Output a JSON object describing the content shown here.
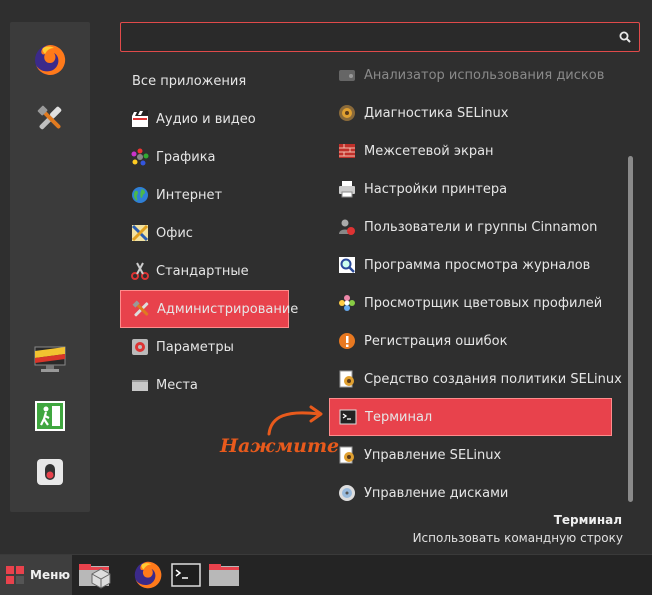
{
  "search": {
    "value": "",
    "placeholder": ""
  },
  "categories": [
    {
      "label": "Все приложения",
      "icon": "none"
    },
    {
      "label": "Аудио и видео",
      "icon": "clapperboard-icon"
    },
    {
      "label": "Графика",
      "icon": "palette-icon"
    },
    {
      "label": "Интернет",
      "icon": "globe-icon"
    },
    {
      "label": "Офис",
      "icon": "office-icon"
    },
    {
      "label": "Стандартные",
      "icon": "scissors-icon"
    },
    {
      "label": "Администрирование",
      "icon": "tools-icon",
      "selected": true
    },
    {
      "label": "Параметры",
      "icon": "settings-icon"
    },
    {
      "label": "Места",
      "icon": "folder-icon"
    }
  ],
  "apps": [
    {
      "label": "Анализатор использования дисков",
      "icon": "disk-usage-icon",
      "dim": true
    },
    {
      "label": "Диагностика SELinux",
      "icon": "selinux-diagnostic-icon"
    },
    {
      "label": "Межсетевой экран",
      "icon": "firewall-icon"
    },
    {
      "label": "Настройки принтера",
      "icon": "printer-icon"
    },
    {
      "label": "Пользователи и группы Cinnamon",
      "icon": "users-icon"
    },
    {
      "label": "Программа просмотра журналов",
      "icon": "log-viewer-icon"
    },
    {
      "label": "Просмотрщик цветовых профилей",
      "icon": "color-profile-icon"
    },
    {
      "label": "Регистрация ошибок",
      "icon": "bug-report-icon"
    },
    {
      "label": "Средство создания политики SELinux",
      "icon": "selinux-policy-icon"
    },
    {
      "label": "Терминал",
      "icon": "terminal-icon",
      "selected": true
    },
    {
      "label": "Управление SELinux",
      "icon": "selinux-manage-icon"
    },
    {
      "label": "Управление дисками",
      "icon": "disks-icon"
    }
  ],
  "description": {
    "title": "Терминал",
    "text": "Использовать командную строку"
  },
  "annotation": "Нажмите",
  "taskbar": {
    "menu_label": "Меню"
  },
  "colors": {
    "accent": "#e8424c",
    "annotation": "#e85a1c"
  }
}
